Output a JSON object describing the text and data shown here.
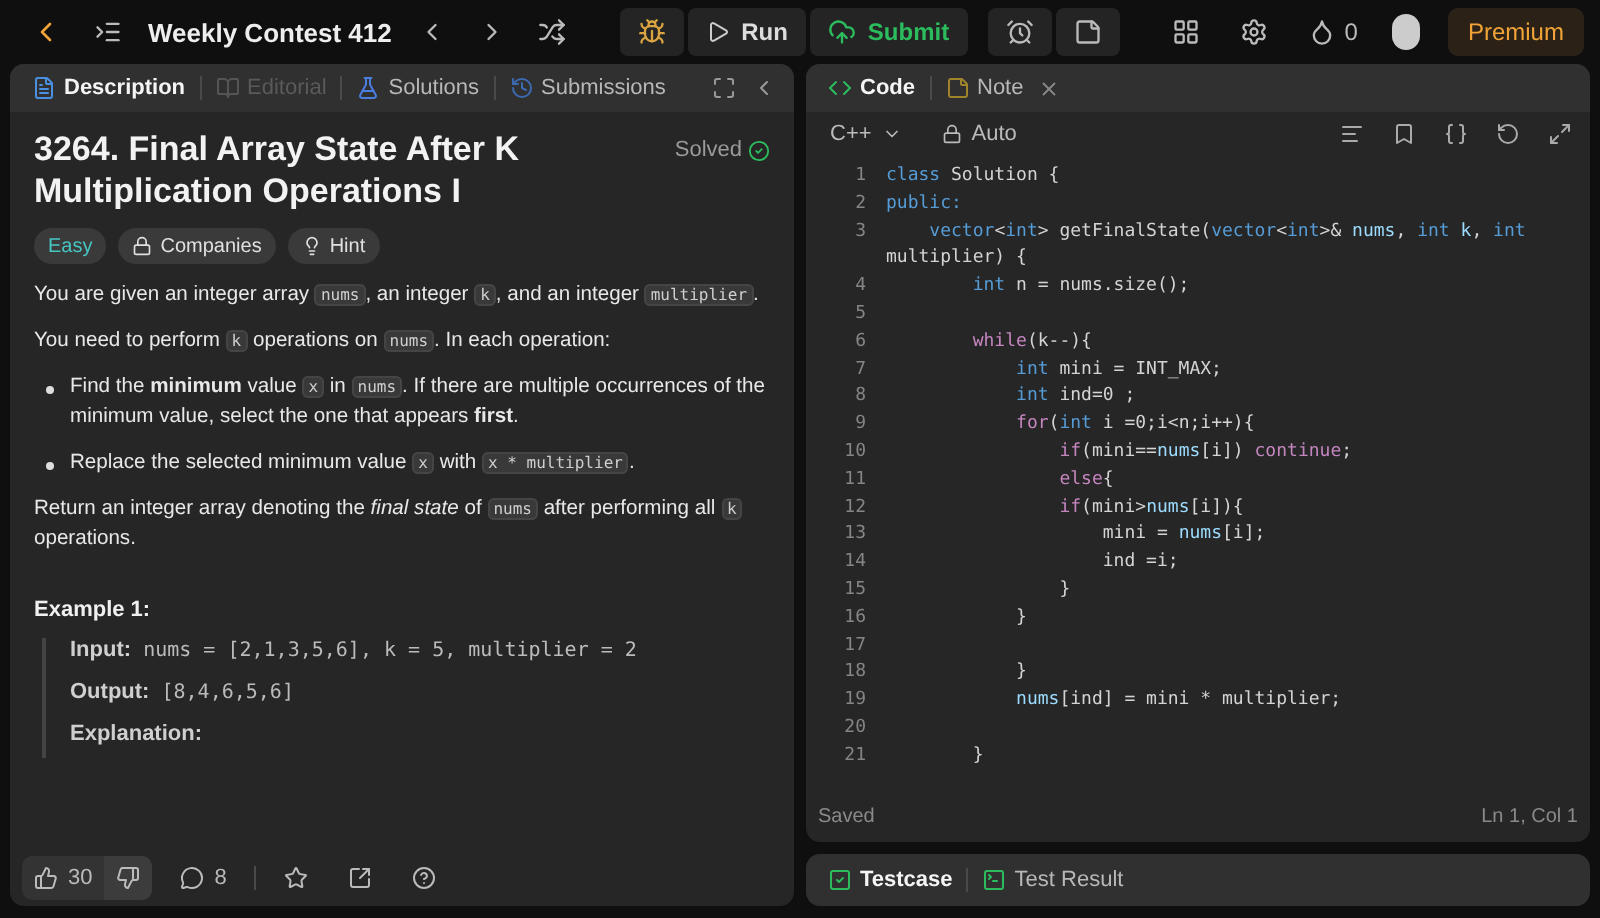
{
  "topbar": {
    "title": "Weekly Contest 412",
    "run": "Run",
    "submit": "Submit",
    "streak": "0",
    "premium": "Premium"
  },
  "description_panel": {
    "tabs": [
      {
        "label": "Description",
        "selected": true,
        "disabled": false,
        "kind": "description"
      },
      {
        "label": "Editorial",
        "selected": false,
        "disabled": true,
        "kind": "editorial"
      },
      {
        "label": "Solutions",
        "selected": false,
        "disabled": false,
        "kind": "solutions"
      },
      {
        "label": "Submissions",
        "selected": false,
        "disabled": false,
        "kind": "submissions"
      }
    ],
    "title": "3264. Final Array State After K Multiplication Operations I",
    "status": "Solved",
    "tags": [
      {
        "label": "Easy",
        "kind": "difficulty"
      },
      {
        "label": "Companies",
        "kind": "companies"
      },
      {
        "label": "Hint",
        "kind": "hint"
      }
    ],
    "blocks": [
      {
        "kind": "paragraph",
        "segments": [
          {
            "kind": "text",
            "text": "You are given an integer array "
          },
          {
            "kind": "code",
            "text": "nums"
          },
          {
            "kind": "text",
            "text": ", an integer "
          },
          {
            "kind": "code",
            "text": "k"
          },
          {
            "kind": "text",
            "text": ", and an integer "
          },
          {
            "kind": "code",
            "text": "multiplier"
          },
          {
            "kind": "text",
            "text": "."
          }
        ]
      },
      {
        "kind": "paragraph",
        "segments": [
          {
            "kind": "text",
            "text": "You need to perform "
          },
          {
            "kind": "code",
            "text": "k"
          },
          {
            "kind": "text",
            "text": " operations on "
          },
          {
            "kind": "code",
            "text": "nums"
          },
          {
            "kind": "text",
            "text": ". In each operation:"
          }
        ]
      },
      {
        "kind": "bullet",
        "segments": [
          {
            "kind": "text",
            "text": "Find the "
          },
          {
            "kind": "bold",
            "text": "minimum"
          },
          {
            "kind": "text",
            "text": " value "
          },
          {
            "kind": "code",
            "text": "x"
          },
          {
            "kind": "text",
            "text": " in "
          },
          {
            "kind": "code",
            "text": "nums"
          },
          {
            "kind": "text",
            "text": ". If there are multiple occurrences of the minimum value, select the one that appears "
          },
          {
            "kind": "bold",
            "text": "first"
          },
          {
            "kind": "text",
            "text": "."
          }
        ]
      },
      {
        "kind": "bullet",
        "segments": [
          {
            "kind": "text",
            "text": "Replace the selected minimum value "
          },
          {
            "kind": "code",
            "text": "x"
          },
          {
            "kind": "text",
            "text": " with "
          },
          {
            "kind": "code",
            "text": "x * multiplier"
          },
          {
            "kind": "text",
            "text": "."
          }
        ]
      },
      {
        "kind": "paragraph",
        "segments": [
          {
            "kind": "text",
            "text": "Return an integer array denoting the "
          },
          {
            "kind": "italic",
            "text": "final state"
          },
          {
            "kind": "text",
            "text": " of "
          },
          {
            "kind": "code",
            "text": "nums"
          },
          {
            "kind": "text",
            "text": " after performing all "
          },
          {
            "kind": "code",
            "text": "k"
          },
          {
            "kind": "text",
            "text": " operations."
          }
        ]
      }
    ],
    "example": {
      "title": "Example 1:",
      "rows": [
        {
          "label": "Input:",
          "value": "nums = [2,1,3,5,6], k = 5, multiplier = 2"
        },
        {
          "label": "Output:",
          "value": "[8,4,6,5,6]"
        },
        {
          "label": "Explanation:"
        }
      ]
    },
    "footer": {
      "likes": "30",
      "comments": "8"
    }
  },
  "code_panel": {
    "tabs": [
      {
        "label": "Code",
        "selected": true,
        "kind": "code"
      },
      {
        "label": "Note",
        "selected": false,
        "kind": "note"
      }
    ],
    "language": "C++",
    "mode": "Auto",
    "lines": [
      {
        "number": "1",
        "segments": [
          {
            "kind": "storage",
            "text": "class"
          },
          {
            "kind": "plain",
            "text": " Solution {"
          }
        ]
      },
      {
        "number": "2",
        "segments": [
          {
            "kind": "storage",
            "text": "public:"
          }
        ]
      },
      {
        "number": "3",
        "segments": [
          {
            "kind": "storage",
            "text": "    vector"
          },
          {
            "kind": "plain",
            "text": "<"
          },
          {
            "kind": "storage",
            "text": "int"
          },
          {
            "kind": "plain",
            "text": "> getFinalState("
          },
          {
            "kind": "storage",
            "text": "vector"
          },
          {
            "kind": "plain",
            "text": "<"
          },
          {
            "kind": "storage",
            "text": "int"
          },
          {
            "kind": "plain",
            "text": ">& "
          },
          {
            "kind": "var",
            "text": "nums"
          },
          {
            "kind": "plain",
            "text": ", "
          },
          {
            "kind": "storage",
            "text": "int"
          },
          {
            "kind": "var",
            "text": " k"
          },
          {
            "kind": "plain",
            "text": ", "
          },
          {
            "kind": "storage",
            "text": "int"
          }
        ],
        "continuation": [
          {
            "kind": "plain",
            "text": "multiplier) {"
          }
        ]
      },
      {
        "number": "4",
        "segments": [
          {
            "kind": "storage",
            "text": "        int"
          },
          {
            "kind": "plain",
            "text": " n = nums.size();"
          }
        ]
      },
      {
        "number": "5"
      },
      {
        "number": "6",
        "segments": [
          {
            "kind": "control",
            "text": "        while"
          },
          {
            "kind": "plain",
            "text": "(k--){"
          }
        ]
      },
      {
        "number": "7",
        "segments": [
          {
            "kind": "storage",
            "text": "            int"
          },
          {
            "kind": "plain",
            "text": " mini = INT_MAX;"
          }
        ]
      },
      {
        "number": "8",
        "segments": [
          {
            "kind": "storage",
            "text": "            int"
          },
          {
            "kind": "plain",
            "text": " ind=0 ;"
          }
        ]
      },
      {
        "number": "9",
        "segments": [
          {
            "kind": "control",
            "text": "            for"
          },
          {
            "kind": "plain",
            "text": "("
          },
          {
            "kind": "storage",
            "text": "int"
          },
          {
            "kind": "plain",
            "text": " i =0;i<n;i++){"
          }
        ]
      },
      {
        "number": "10",
        "segments": [
          {
            "kind": "control",
            "text": "                if"
          },
          {
            "kind": "plain",
            "text": "(mini=="
          },
          {
            "kind": "var",
            "text": "nums"
          },
          {
            "kind": "plain",
            "text": "[i]) "
          },
          {
            "kind": "control",
            "text": "continue"
          },
          {
            "kind": "plain",
            "text": ";"
          }
        ]
      },
      {
        "number": "11",
        "segments": [
          {
            "kind": "control",
            "text": "                else"
          },
          {
            "kind": "plain",
            "text": "{"
          }
        ]
      },
      {
        "number": "12",
        "segments": [
          {
            "kind": "control",
            "text": "                if"
          },
          {
            "kind": "plain",
            "text": "(mini>"
          },
          {
            "kind": "var",
            "text": "nums"
          },
          {
            "kind": "plain",
            "text": "[i]){"
          }
        ]
      },
      {
        "number": "13",
        "segments": [
          {
            "kind": "plain",
            "text": "                    mini = "
          },
          {
            "kind": "var",
            "text": "nums"
          },
          {
            "kind": "plain",
            "text": "[i];"
          }
        ]
      },
      {
        "number": "14",
        "segments": [
          {
            "kind": "plain",
            "text": "                    ind =i;"
          }
        ]
      },
      {
        "number": "15",
        "segments": [
          {
            "kind": "plain",
            "text": "                }"
          }
        ]
      },
      {
        "number": "16",
        "segments": [
          {
            "kind": "plain",
            "text": "            }"
          }
        ]
      },
      {
        "number": "17"
      },
      {
        "number": "18",
        "segments": [
          {
            "kind": "plain",
            "text": "            }"
          }
        ]
      },
      {
        "number": "19",
        "segments": [
          {
            "kind": "var",
            "text": "            nums"
          },
          {
            "kind": "plain",
            "text": "[ind] = mini * multiplier;"
          }
        ]
      },
      {
        "number": "20"
      },
      {
        "number": "21",
        "segments": [
          {
            "kind": "plain",
            "text": "        }"
          }
        ]
      }
    ],
    "status": "Saved",
    "cursor": "Ln 1, Col 1"
  },
  "test_panel": {
    "tabs": [
      {
        "label": "Testcase",
        "selected": true,
        "kind": "testcase"
      },
      {
        "label": "Test Result",
        "selected": false,
        "kind": "result"
      }
    ]
  }
}
